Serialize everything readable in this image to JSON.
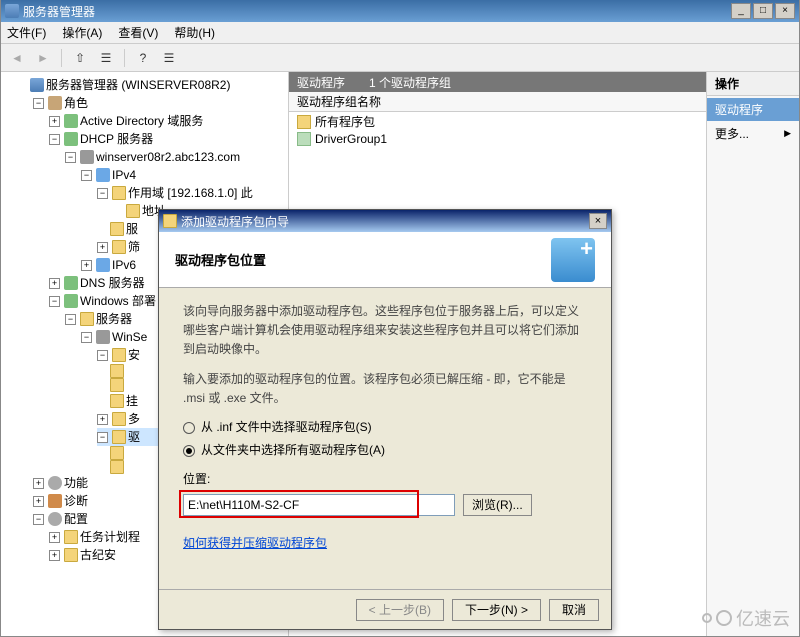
{
  "window": {
    "title": "服务器管理器",
    "menus": {
      "file": "文件(F)",
      "action": "操作(A)",
      "view": "查看(V)",
      "help": "帮助(H)"
    },
    "win_btns": {
      "min": "_",
      "max": "□",
      "close": "×"
    }
  },
  "tree": {
    "root": "服务器管理器 (WINSERVER08R2)",
    "roles": "角色",
    "ad": "Active Directory 域服务",
    "dhcp": "DHCP 服务器",
    "host": "winserver08r2.abc123.com",
    "ipv4": "IPv4",
    "scope": "作用域 [192.168.1.0] 此",
    "pool": "地址",
    "srv": "服",
    "filter": "筛",
    "ipv6": "IPv6",
    "dns": "DNS 服务器",
    "wds": "Windows 部署",
    "wds_srv": "服务器",
    "wds_host": "WinSe",
    "inst": "安",
    "cfg1": "挂",
    "cfg2": "多",
    "drv": "驱",
    "features": "功能",
    "diag": "诊断",
    "config": "配置",
    "tasks": "任务计划程",
    "tasks_sub": "古纪安"
  },
  "mid": {
    "header_left": "驱动程序",
    "header_right": "1 个驱动程序组",
    "col": "驱动程序组名称",
    "row1": "所有程序包",
    "row2": "DriverGroup1"
  },
  "actions": {
    "title": "操作",
    "group": "驱动程序",
    "more": "更多..."
  },
  "wizard": {
    "title": "添加驱动程序包向导",
    "heading": "驱动程序包位置",
    "para1": "该向导向服务器中添加驱动程序包。这些程序包位于服务器上后，可以定义哪些客户端计算机会使用驱动程序组来安装这些程序包并且可以将它们添加到启动映像中。",
    "para2": "输入要添加的驱动程序包的位置。该程序包必须已解压缩 - 即，它不能是 .msi 或 .exe 文件。",
    "radio_inf": "从 .inf 文件中选择驱动程序包(S)",
    "radio_folder": "从文件夹中选择所有驱动程序包(A)",
    "loc_label": "位置:",
    "loc_value": "E:\\net\\H110M-S2-CF",
    "browse": "浏览(R)...",
    "link": "如何获得并压缩驱动程序包",
    "back": "< 上一步(B)",
    "next": "下一步(N) >",
    "cancel": "取消",
    "close": "×"
  },
  "watermark": "亿速云"
}
